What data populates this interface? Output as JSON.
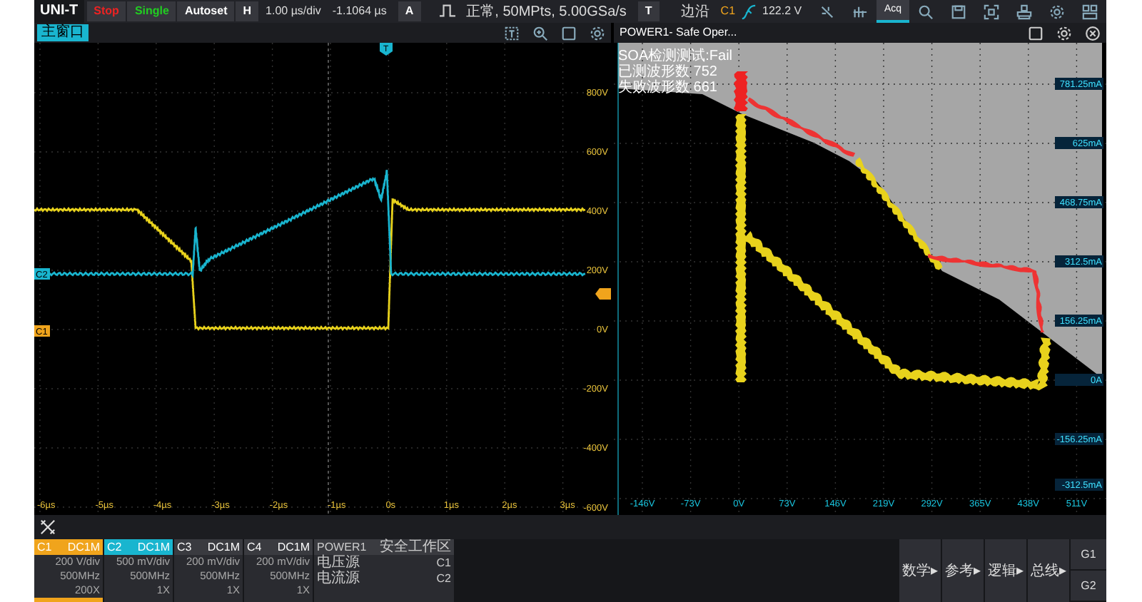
{
  "top_bar": {
    "logo": "UNI-T",
    "run_state": "Stop",
    "single": "Single",
    "autoset": "Autoset",
    "horizontal_label": "H",
    "timebase": "1.00 µs/div",
    "delay": "-1.1064 µs",
    "acq_label": "A",
    "acq_info": "正常, 50MPts, 5.00GSa/s",
    "trigger_label": "T",
    "trigger_type": "边沿",
    "trigger_source": "C1",
    "trigger_level": "122.2 V",
    "tools": [
      {
        "kind": "cursor",
        "selected": false
      },
      {
        "kind": "measure",
        "selected": false
      },
      {
        "kind": "acquire",
        "label": "Acq",
        "selected": true
      },
      {
        "kind": "search",
        "selected": false
      },
      {
        "kind": "save",
        "selected": false
      },
      {
        "kind": "screenshot",
        "selected": false
      },
      {
        "kind": "print",
        "selected": false
      },
      {
        "kind": "settings",
        "selected": false
      },
      {
        "kind": "layout",
        "selected": false
      }
    ]
  },
  "main_window": {
    "tab": "主窗口",
    "trigger_marker": "T",
    "time_labels": [
      "-6µs",
      "-5µs",
      "-4µs",
      "-3µs",
      "-2µs",
      "-1µs",
      "0s",
      "1µs",
      "2µs",
      "3µs"
    ],
    "voltage_labels": [
      "800V",
      "600V",
      "400V",
      "200V",
      "0V",
      "-200V",
      "-400V",
      "-600V"
    ],
    "markers": [
      {
        "label": "C2",
        "color": "#19b5cf"
      },
      {
        "label": "C1",
        "color": "#f0a41c"
      }
    ]
  },
  "soa_window": {
    "title": "POWER1- Safe Oper...",
    "status_lines": [
      "SOA检测测试:Fail",
      "已测波形数 752",
      "失败波形数 661"
    ],
    "current_labels": [
      "781.25mA",
      "625mA",
      "468.75mA",
      "312.5mA",
      "156.25mA",
      "0A",
      "-156.25mA",
      "-312.5mA"
    ],
    "voltage_labels": [
      "-146V",
      "-73V",
      "0V",
      "73V",
      "146V",
      "219V",
      "292V",
      "365V",
      "438V",
      "511V"
    ]
  },
  "channels": [
    {
      "name": "C1",
      "coupling": "DC1M",
      "scale": "200 V/div",
      "bandwidth": "500MHz",
      "probe": "200X",
      "color": "#f0a41c",
      "selected": true
    },
    {
      "name": "C2",
      "coupling": "DC1M",
      "scale": "500 mV/div",
      "bandwidth": "500MHz",
      "probe": "1X",
      "color": "#19b5cf",
      "selected": false
    },
    {
      "name": "C3",
      "coupling": "DC1M",
      "scale": "200 mV/div",
      "bandwidth": "500MHz",
      "probe": "1X",
      "selected": false
    },
    {
      "name": "C4",
      "coupling": "DC1M",
      "scale": "200 mV/div",
      "bandwidth": "500MHz",
      "probe": "1X",
      "selected": false
    }
  ],
  "power": {
    "name": "POWER1",
    "function": "安全工作区",
    "rows": [
      {
        "label": "电压源",
        "value": "C1"
      },
      {
        "label": "电流源",
        "value": "C2"
      }
    ]
  },
  "menu_buttons": [
    "数学▸",
    "参考▸",
    "逻辑▸",
    "总线▸"
  ],
  "groups": [
    "G1",
    "G2"
  ]
}
